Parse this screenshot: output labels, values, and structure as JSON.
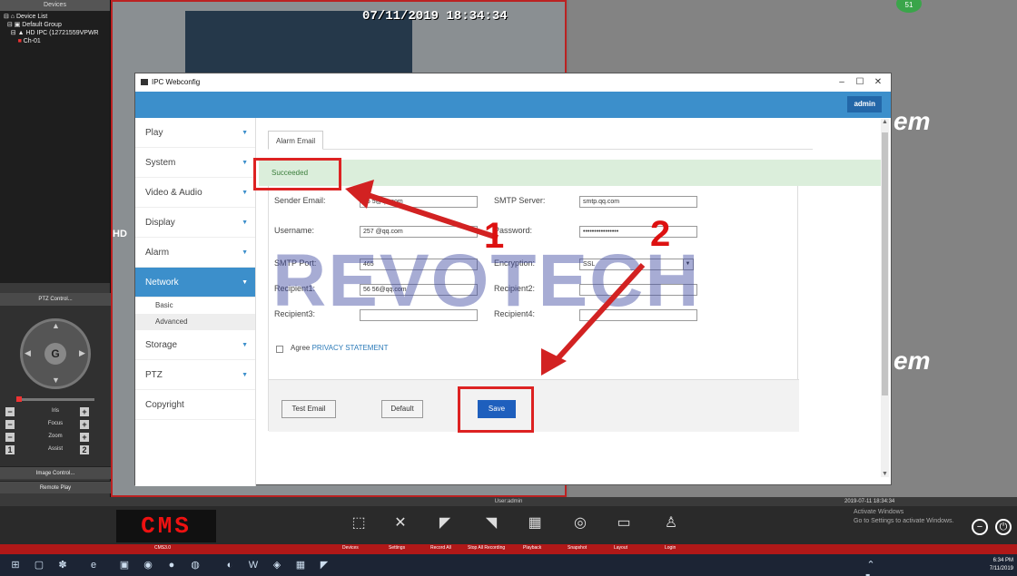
{
  "cms": {
    "left_header": "Devices",
    "tree": [
      "Device List",
      "Default Group",
      "HD IPC (12721559VPWR",
      "Ch-01"
    ],
    "ptz_control": "PTZ Control...",
    "ptz_rows": [
      "Iris",
      "Focus",
      "Zoom",
      "Assist"
    ],
    "image_control": "Image Control...",
    "remote_play": "Remote Play",
    "video_timestamp": "07/11/2019 18:34:34",
    "video_overlay_text": "HD",
    "badge": "51",
    "brand_fragment": "em",
    "status_user": "User:admin",
    "status_time": "2019-07-11 18:34:34",
    "logo": "CMS",
    "version": "CMS3.0",
    "toolbar": [
      {
        "label": "Devices",
        "icon": "⬚"
      },
      {
        "label": "Settings",
        "icon": "✕"
      },
      {
        "label": "Record All",
        "icon": "◤"
      },
      {
        "label": "Stop All Recording",
        "icon": "◥"
      },
      {
        "label": "Playback",
        "icon": "▦"
      },
      {
        "label": "Snapshot",
        "icon": "◎"
      },
      {
        "label": "Layout",
        "icon": "▭"
      },
      {
        "label": "Login",
        "icon": "♙"
      }
    ],
    "activate_1": "Activate Windows",
    "activate_2": "Go to Settings to activate Windows."
  },
  "window": {
    "title": "IPC Webconfig",
    "user": "admin",
    "menu": [
      {
        "label": "Play"
      },
      {
        "label": "System"
      },
      {
        "label": "Video & Audio"
      },
      {
        "label": "Display"
      },
      {
        "label": "Alarm"
      },
      {
        "label": "Network"
      },
      {
        "label": "Storage"
      },
      {
        "label": "PTZ"
      },
      {
        "label": "Copyright"
      }
    ],
    "submenu": [
      "Basic",
      "Advanced"
    ]
  },
  "form": {
    "tab": "Alarm Email",
    "success": "Succeeded",
    "sender_email_label": "Sender Email:",
    "sender_email_value": "25      5@qq.com",
    "smtp_server_label": "SMTP Server:",
    "smtp_server_value": "smtp.qq.com",
    "username_label": "Username:",
    "username_value": "257      @qq.com",
    "password_label": "Password:",
    "password_value": "••••••••••••••••",
    "smtp_port_label": "SMTP Port:",
    "smtp_port_value": "465",
    "encryption_label": "Encryption:",
    "encryption_value": "SSL",
    "recipient1_label": "Recipient1:",
    "recipient1_value": "56     56@qq.com",
    "recipient2_label": "Recipient2:",
    "recipient3_label": "Recipient3:",
    "recipient4_label": "Recipient4:",
    "agree": "Agree",
    "privacy": "PRIVACY STATEMENT",
    "test_email": "Test Email",
    "default": "Default",
    "save": "Save"
  },
  "watermark": "REVOTECH",
  "annotations": {
    "n1": "1",
    "n2": "2",
    "color": "#d22222"
  },
  "taskbar": {
    "time": "6:34 PM",
    "date": "7/11/2019"
  }
}
